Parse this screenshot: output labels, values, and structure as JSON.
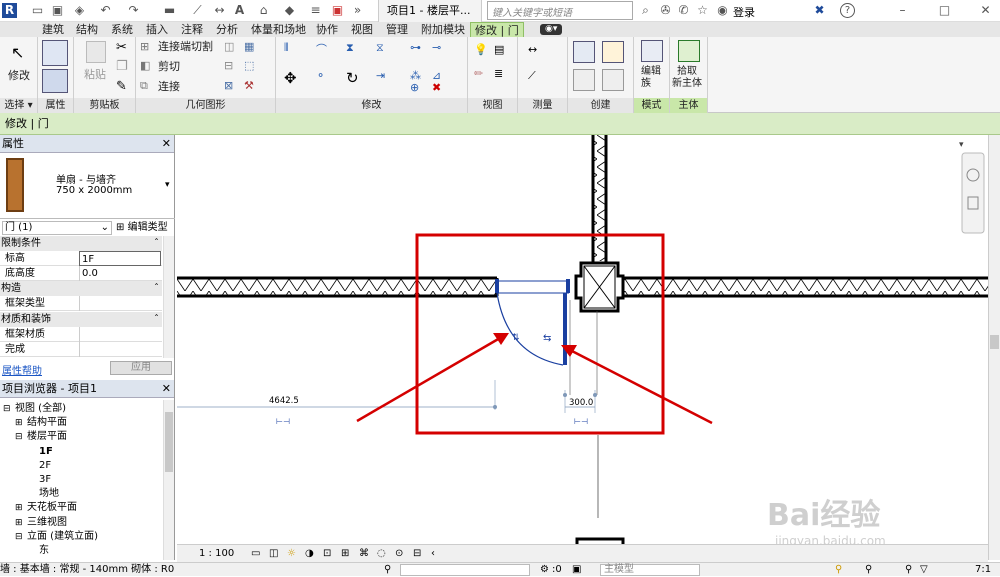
{
  "titlebar": {
    "doc_title": "项目1 - 楼层平...",
    "search_placeholder": "键入关键字或短语",
    "login": "登录",
    "overflow": "»",
    "help": "?",
    "window_buttons": [
      "–",
      "□",
      "✕"
    ]
  },
  "tabs": [
    "建筑",
    "结构",
    "系统",
    "插入",
    "注释",
    "分析",
    "体量和场地",
    "协作",
    "视图",
    "管理",
    "附加模块",
    "修改 | 门"
  ],
  "ribbon": {
    "modify_label": "修改",
    "paste_label": "粘贴",
    "join_cut_label": "连接端切割",
    "cut_label": "剪切",
    "join_label": "连接",
    "edit_family_label": "编辑\n族",
    "pick_host_label": "拾取\n新主体",
    "panels": [
      "选择",
      "属性",
      "剪贴板",
      "几何图形",
      "修改",
      "视图",
      "测量",
      "创建",
      "模式",
      "主体"
    ]
  },
  "context_bar": "修改 | 门",
  "properties": {
    "title": "属性",
    "type_name": "单扇 - 与墙齐",
    "type_size": "750 x 2000mm",
    "selector": "门 (1)",
    "edit_type": "编辑类型",
    "groups": [
      {
        "name": "限制条件",
        "rows": [
          {
            "k": "标高",
            "v": "1F"
          },
          {
            "k": "底高度",
            "v": "0.0"
          }
        ]
      },
      {
        "name": "构造",
        "rows": [
          {
            "k": "框架类型",
            "v": ""
          }
        ]
      },
      {
        "name": "材质和装饰",
        "rows": [
          {
            "k": "框架材质",
            "v": ""
          },
          {
            "k": "完成",
            "v": ""
          }
        ]
      }
    ],
    "help_link": "属性帮助",
    "apply": "应用"
  },
  "browser": {
    "title": "项目浏览器 - 项目1",
    "items": [
      {
        "label": "视图 (全部)",
        "level": 0,
        "toggle": "⊟"
      },
      {
        "label": "结构平面",
        "level": 1,
        "toggle": "⊞"
      },
      {
        "label": "楼层平面",
        "level": 1,
        "toggle": "⊟"
      },
      {
        "label": "1F",
        "level": 2,
        "toggle": "",
        "bold": true
      },
      {
        "label": "2F",
        "level": 2,
        "toggle": ""
      },
      {
        "label": "3F",
        "level": 2,
        "toggle": ""
      },
      {
        "label": "场地",
        "level": 2,
        "toggle": ""
      },
      {
        "label": "天花板平面",
        "level": 1,
        "toggle": "⊞"
      },
      {
        "label": "三维视图",
        "level": 1,
        "toggle": "⊞"
      },
      {
        "label": "立面 (建筑立面)",
        "level": 1,
        "toggle": "⊟"
      },
      {
        "label": "东",
        "level": 2,
        "toggle": ""
      }
    ]
  },
  "canvas": {
    "dim_left": "4642.5",
    "dim_right": "300.0"
  },
  "viewbar": {
    "scale": "1 : 100"
  },
  "statusbar": {
    "text": "墙 : 基本墙 : 常规 - 140mm 砌体 : R0",
    "count": ":0",
    "model": "主模型",
    "filter": "7:1"
  },
  "watermark": {
    "brand": "Bai经验",
    "url": "jingyan.baidu.com"
  },
  "colors": {
    "highlight": "#d40000",
    "selection": "#1a3fa0",
    "ribbon_active": "#c9e7a9"
  }
}
